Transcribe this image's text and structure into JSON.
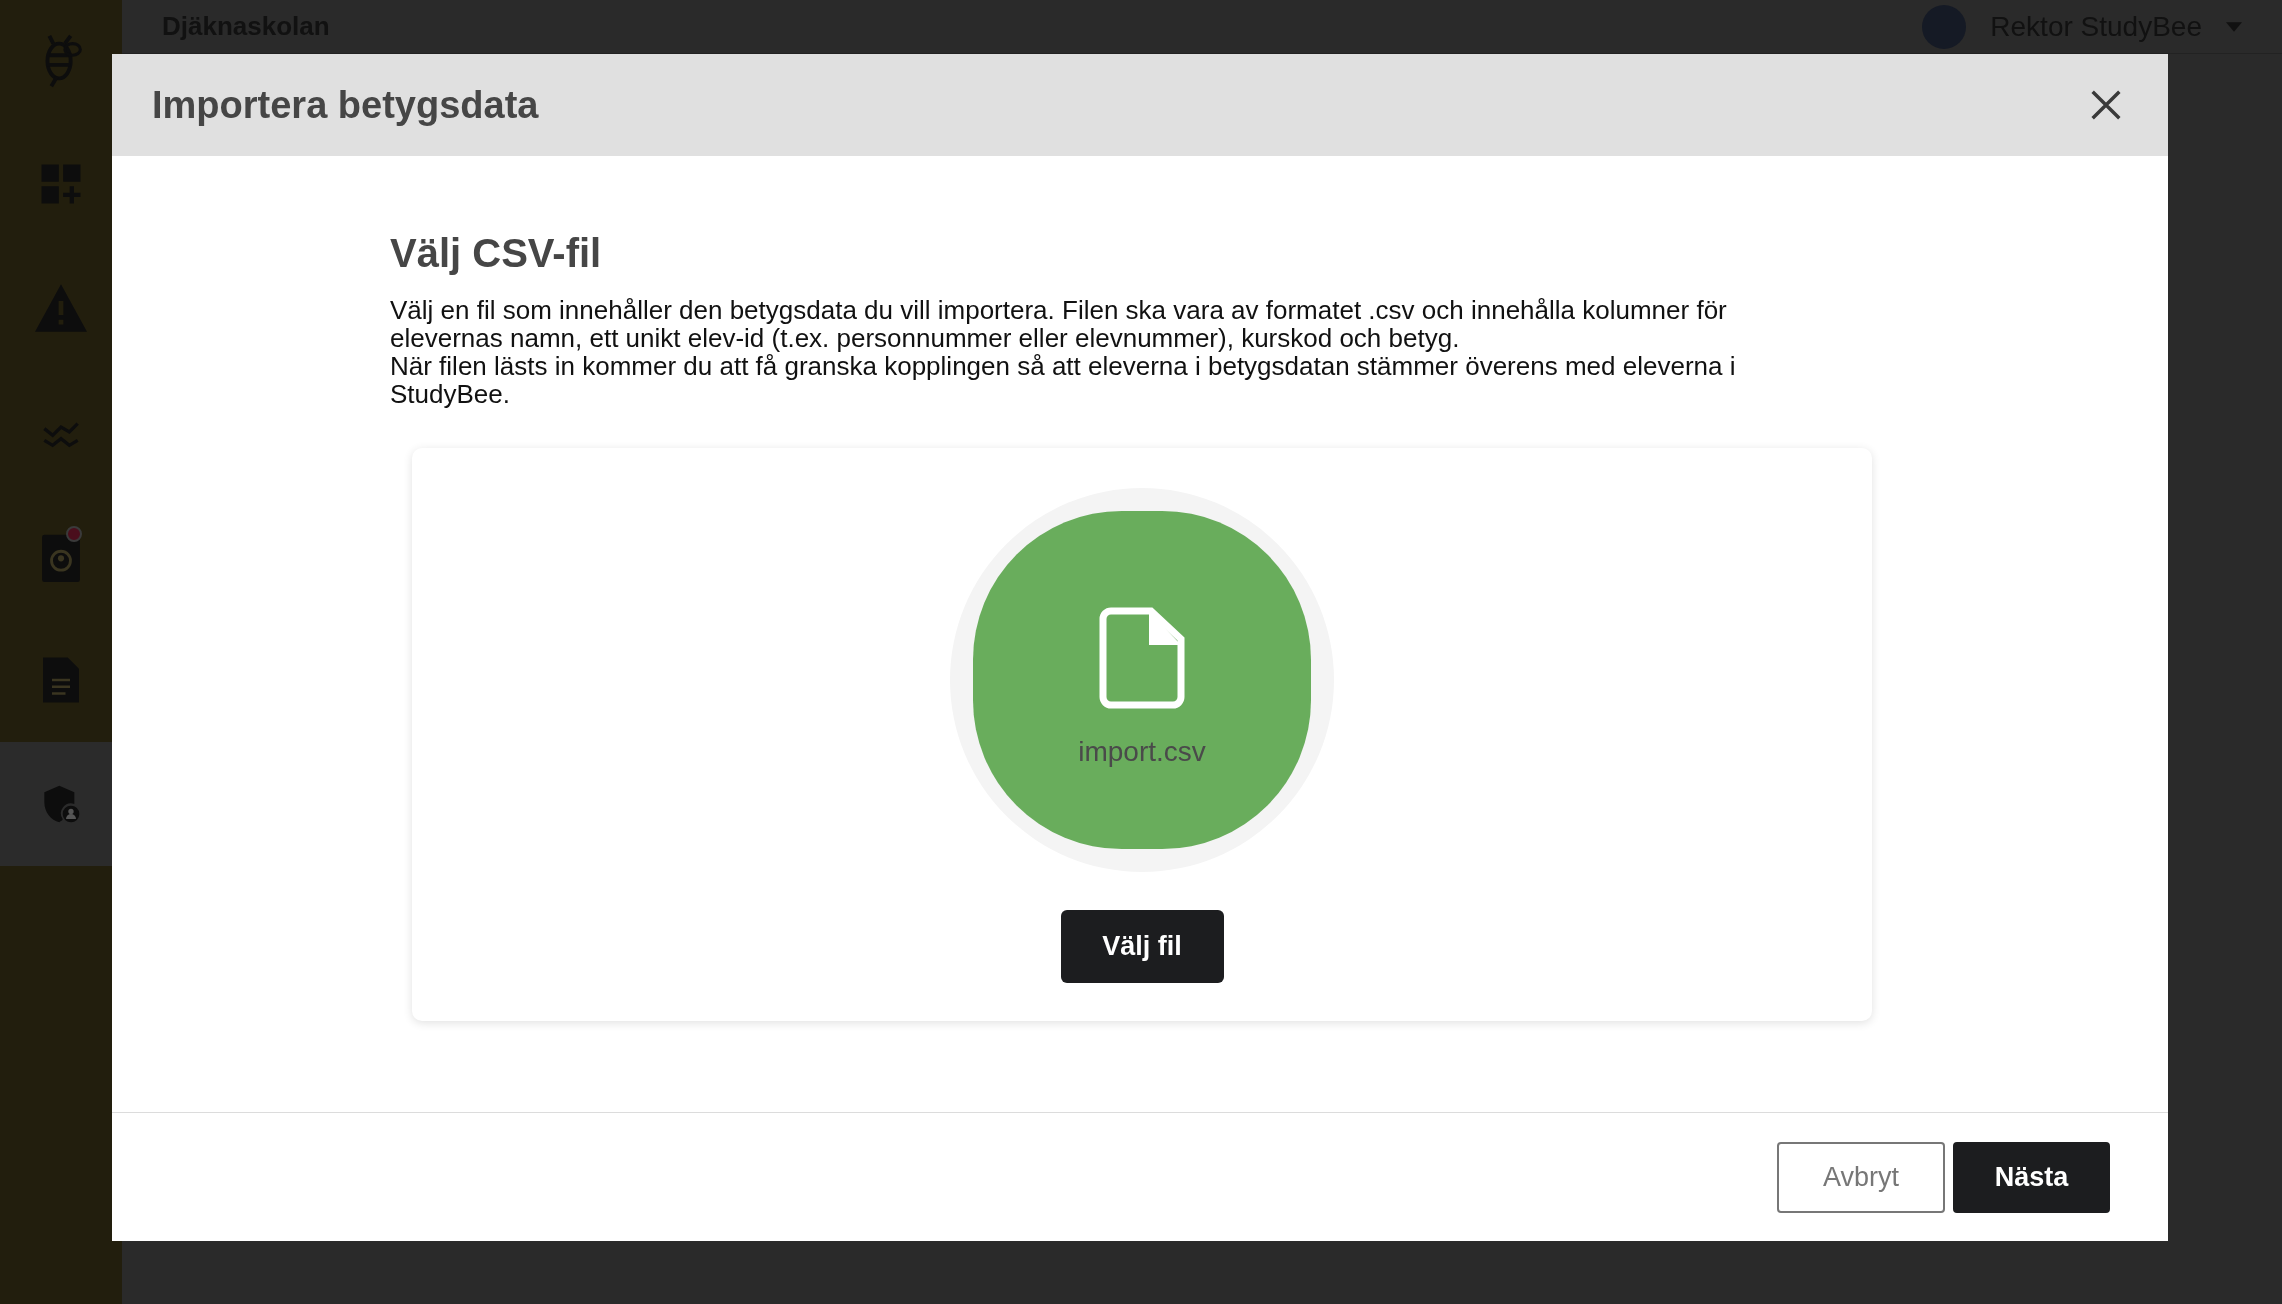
{
  "header": {
    "school": "Djäknaskolan",
    "user": "Rektor StudyBee"
  },
  "sidebar": {
    "items": [
      {
        "kind": "dashboard",
        "selected": false,
        "badge": false
      },
      {
        "kind": "warning",
        "selected": false,
        "badge": false
      },
      {
        "kind": "waves",
        "selected": false,
        "badge": false
      },
      {
        "kind": "contact",
        "selected": false,
        "badge": true
      },
      {
        "kind": "document",
        "selected": false,
        "badge": false
      },
      {
        "kind": "shield",
        "selected": true,
        "badge": false
      }
    ]
  },
  "dialog": {
    "title": "Importera betygsdata",
    "heading": "Välj CSV-fil",
    "description": [
      "Välj en fil som innehåller den betygsdata du vill importera. Filen ska vara av formatet .csv och innehålla kolumner för elevernas namn, ett unikt elev-id (t.ex. personnummer eller elevnummer), kurskod och betyg.",
      "När filen lästs in kommer du att få granska kopplingen så att eleverna i betygsdatan stämmer överens med eleverna i StudyBee."
    ],
    "file": {
      "name": "import.csv",
      "loaded": true
    },
    "choose_button": "Välj fil",
    "buttons": [
      {
        "label": "Avbryt",
        "kind": "secondary"
      },
      {
        "label": "Nästa",
        "kind": "primary"
      }
    ]
  }
}
